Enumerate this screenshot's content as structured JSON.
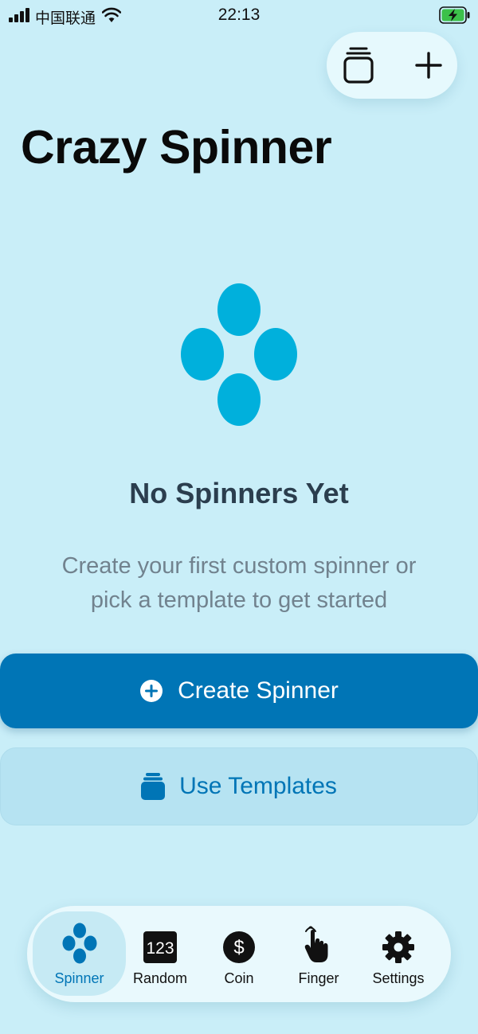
{
  "status_bar": {
    "carrier": "中国联通",
    "time": "22:13"
  },
  "app": {
    "title": "Crazy Spinner"
  },
  "empty_state": {
    "heading": "No Spinners Yet",
    "description_line1": "Create your first custom spinner or",
    "description_line2": "pick a template to get started"
  },
  "buttons": {
    "create": "Create Spinner",
    "templates": "Use Templates"
  },
  "tabs": [
    {
      "label": "Spinner",
      "icon": "spinner-icon",
      "active": true
    },
    {
      "label": "Random",
      "icon": "dice-123-icon",
      "active": false
    },
    {
      "label": "Coin",
      "icon": "dollar-coin-icon",
      "active": false
    },
    {
      "label": "Finger",
      "icon": "hand-tap-icon",
      "active": false
    },
    {
      "label": "Settings",
      "icon": "gear-icon",
      "active": false
    }
  ],
  "random_icon_text": "123",
  "coin_icon_text": "$",
  "colors": {
    "background": "#c9eef8",
    "accent": "#0075b6",
    "spinner_logo": "#00b0dc",
    "heading": "#2b3e4e",
    "secondary_text": "#71828e"
  }
}
